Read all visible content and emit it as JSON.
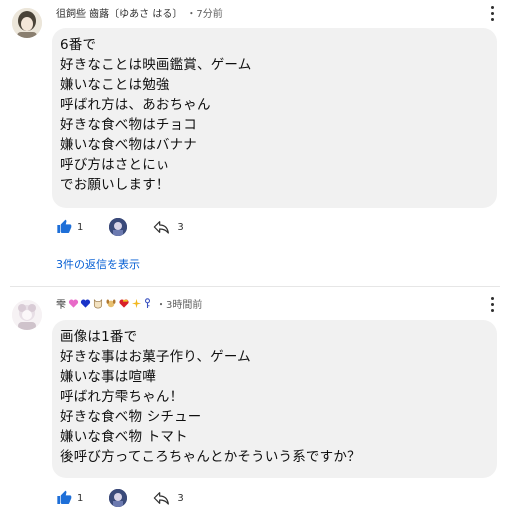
{
  "comments": [
    {
      "author": "徂飼些 齒蕗〔ゆあさ はる〕",
      "time": "・7分前",
      "lines": [
        "6番で",
        "好きなことは映画鑑賞、ゲーム",
        "嫌いなことは勉強",
        "呼ばれ方は、あおちゃん",
        "好きな食べ物はチョコ",
        "嫌いな食べ物はバナナ",
        "呼び方はさとにぃ",
        "でお願いします！"
      ],
      "like_count": "1",
      "reply_count": "3",
      "view_replies": "3件の返信を表示"
    },
    {
      "author_prefix": "雫",
      "badge_icons": [
        "pink-heart-icon",
        "blue-heart-icon",
        "cat-face-icon",
        "dog-face-icon",
        "heart-bow-icon",
        "sparkle-icon",
        "key-icon"
      ],
      "time": "・3時間前",
      "lines": [
        "画像は1番で",
        "好きな事はお菓子作り、ゲーム",
        "嫌いな事は喧嘩",
        "呼ばれ方雫ちゃん！",
        "好きな食べ物 シチュー",
        "嫌いな食べ物 トマト",
        "後呼び方ってころちゃんとかそういう系ですか？"
      ],
      "like_count": "1",
      "reply_count": "3"
    }
  ],
  "colors": {
    "link": "#065fd4",
    "like": "#1e6fd8",
    "bubble": "#f1f1f1"
  }
}
